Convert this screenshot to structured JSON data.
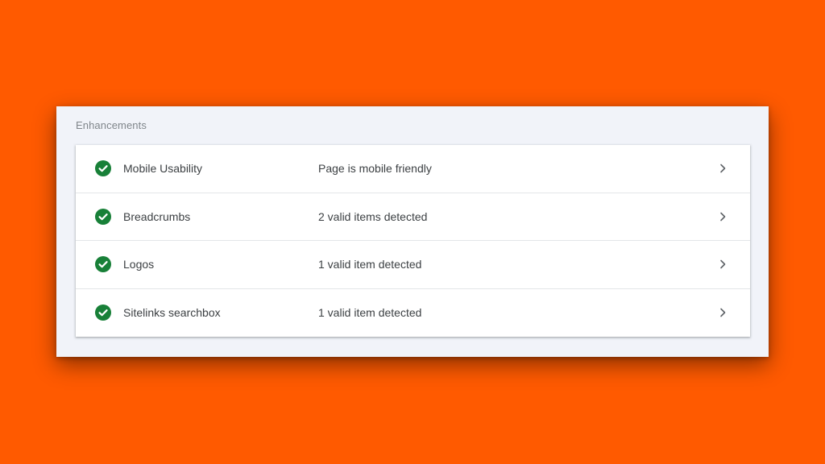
{
  "colors": {
    "background": "#FF5A00",
    "panel": "#F1F3F9",
    "card": "#FFFFFF",
    "success": "#188038",
    "text": "#3C4043",
    "muted": "#80868B"
  },
  "enhancements": {
    "title": "Enhancements",
    "items": [
      {
        "name": "Mobile Usability",
        "status": "Page is mobile friendly",
        "icon": "check-circle-icon",
        "state": "valid"
      },
      {
        "name": "Breadcrumbs",
        "status": "2 valid items detected",
        "icon": "check-circle-icon",
        "state": "valid"
      },
      {
        "name": "Logos",
        "status": "1 valid item detected",
        "icon": "check-circle-icon",
        "state": "valid"
      },
      {
        "name": "Sitelinks searchbox",
        "status": "1 valid item detected",
        "icon": "check-circle-icon",
        "state": "valid"
      }
    ]
  }
}
